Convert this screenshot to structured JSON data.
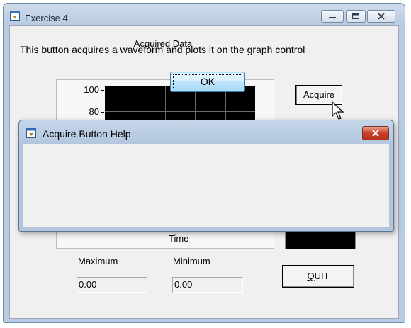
{
  "window": {
    "title": "Exercise 4"
  },
  "graph": {
    "title": "Acquired Data",
    "y_ticks": [
      "100",
      "80"
    ],
    "x_axis_label": "Time"
  },
  "acquire_button": {
    "label": "Acquire"
  },
  "stats": {
    "maximum_label": "Maximum",
    "maximum_value": "0.00",
    "minimum_label": "Minimum",
    "minimum_value": "0.00"
  },
  "quit_button": {
    "label_underlined": "Q",
    "label_rest": "UIT"
  },
  "dialog": {
    "title": "Acquire Button Help",
    "message": "This button acquires a waveform and plots it on the graph control",
    "ok_underlined": "O",
    "ok_rest": "K"
  },
  "colors": {
    "plot_background": "#000000",
    "dialog_close": "#c9402c",
    "ok_focus_border": "#3c7fb1"
  },
  "icons": [
    "app-window-icon",
    "minimize-icon",
    "maximize-icon",
    "close-icon",
    "mouse-cursor-icon"
  ]
}
